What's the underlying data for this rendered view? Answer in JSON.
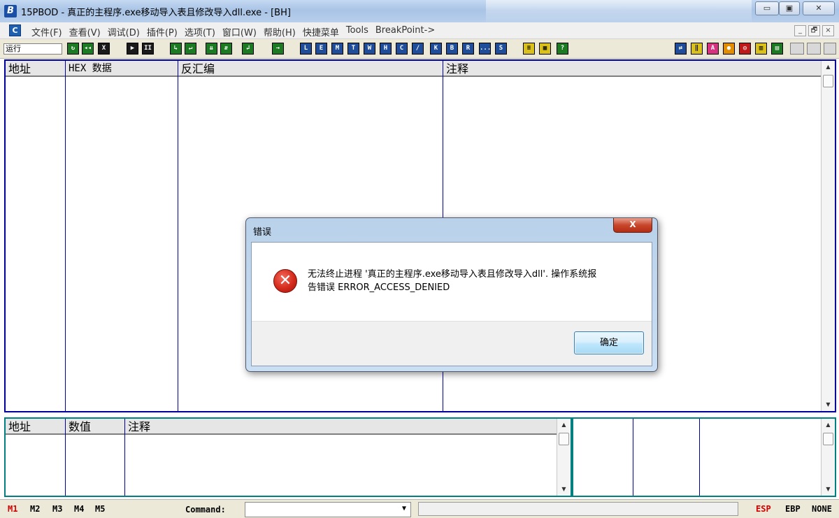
{
  "window": {
    "title": "15PBOD - 真正的主程序.exe移动导入表且修改导入dll.exe - [BH]",
    "app_icon": "app-logo-icon",
    "controls": {
      "minimize": "▭",
      "maximize": "▣",
      "close": "✕"
    }
  },
  "menu": {
    "items": [
      "文件(F)",
      "查看(V)",
      "调试(D)",
      "插件(P)",
      "选项(T)",
      "窗口(W)",
      "帮助(H)",
      "快捷菜单",
      "Tools",
      "BreakPoint->"
    ],
    "mdi": {
      "minimize": "_",
      "restore": "🗗",
      "close": "×"
    }
  },
  "toolbar": {
    "status": "运行",
    "group1": [
      "↻",
      "◂◂",
      "X"
    ],
    "group2": [
      "▶",
      "II"
    ],
    "group3": [
      "↳",
      "↵",
      "⇊",
      "⇵",
      "↲",
      "→"
    ],
    "group4": [
      "L",
      "E",
      "M",
      "T",
      "W",
      "H",
      "C",
      "/",
      "K",
      "B",
      "R",
      "...",
      "S"
    ],
    "group5": [
      "≡",
      "▦",
      "?"
    ],
    "group6": [
      "⇄",
      "‖",
      "A",
      "●",
      "◎",
      "▥",
      "▤"
    ],
    "colors": {
      "green": "#1b7a22",
      "dark": "#1a1a1a",
      "blue": "#1f4d99",
      "yellow": "#d9c01a"
    }
  },
  "cpu_pane": {
    "headers": {
      "address": "地址",
      "hex": "HEX 数据",
      "disasm": "反汇编",
      "comment": "注释"
    },
    "border_color": "#0000a0"
  },
  "dump_pane": {
    "headers": {
      "address": "地址",
      "value": "数值",
      "comment": "注释"
    }
  },
  "statusbar": {
    "mem_tabs": [
      "M1",
      "M2",
      "M3",
      "M4",
      "M5"
    ],
    "command_label": "Command:",
    "command_value": "",
    "registers": [
      "ESP",
      "EBP",
      "NONE"
    ],
    "active_color": "#d40000"
  },
  "dialog": {
    "title": "错误",
    "close": "X",
    "message_line1": "无法终止进程 '真正的主程序.exe移动导入表且修改导入dll'. 操作系统报",
    "message_line2": "告错误 ERROR_ACCESS_DENIED",
    "ok": "确定",
    "icon": "error-icon"
  }
}
